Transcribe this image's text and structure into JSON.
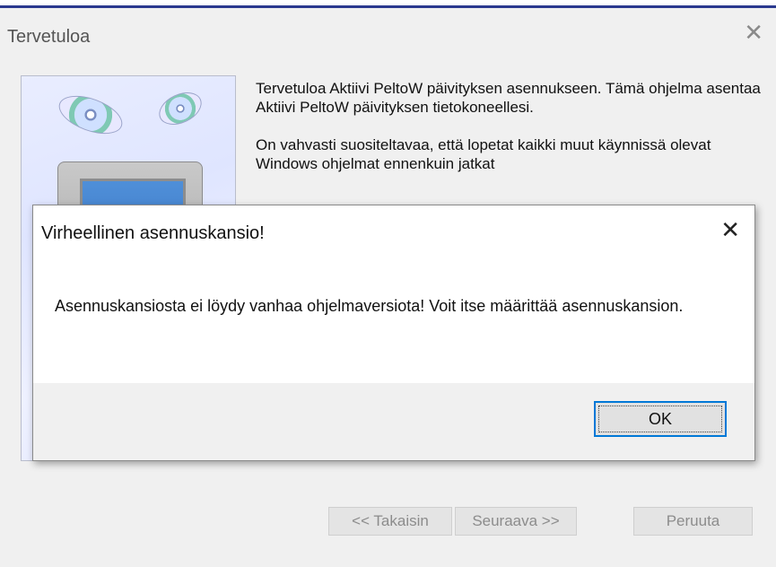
{
  "installer": {
    "title": "Tervetuloa",
    "paragraph1": "Tervetuloa Aktiivi PeltoW päivityksen asennukseen. Tämä ohjelma asentaa Aktiivi PeltoW päivityksen tietokoneellesi.",
    "paragraph2": "On vahvasti suositeltavaa, että lopetat kaikki muut käynnissä olevat Windows ohjelmat ennenkuin jatkat",
    "tail_text": "... , , , , ... ,",
    "buttons": {
      "back": "<< Takaisin",
      "next": "Seuraava >>",
      "cancel": "Peruuta"
    }
  },
  "dialog": {
    "title": "Virheellinen asennuskansio!",
    "message": "Asennuskansiosta ei löydy vanhaa ohjelmaversiota! Voit itse määrittää asennuskansion.",
    "ok_label": "OK"
  },
  "icons": {
    "installer_close": "close-icon",
    "dialog_close": "close-icon"
  },
  "colors": {
    "focus_border": "#0078d7",
    "banner_background": "#e2e7ff"
  }
}
